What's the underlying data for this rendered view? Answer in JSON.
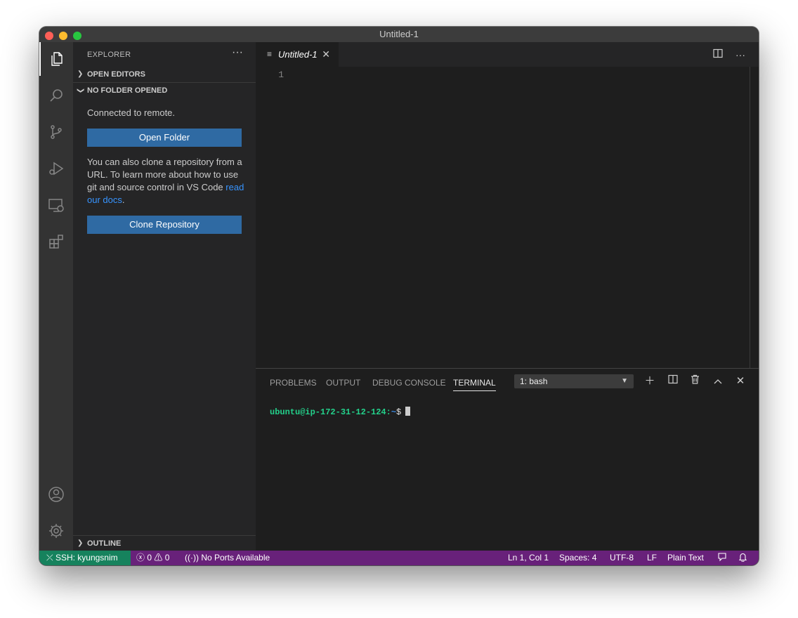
{
  "window": {
    "title": "Untitled-1"
  },
  "sidebar": {
    "title": "EXPLORER",
    "more": "···",
    "open_editors": "OPEN EDITORS",
    "no_folder": "NO FOLDER OPENED",
    "connected": "Connected to remote.",
    "open_folder_btn": "Open Folder",
    "clone_text_pre": "You can also clone a repository from a URL. To learn more about how to use git and source control in VS Code ",
    "clone_link": "read our docs",
    "clone_text_post": ".",
    "clone_btn": "Clone Repository",
    "outline": "OUTLINE"
  },
  "editor": {
    "tab_label": "Untitled-1",
    "line_number": "1",
    "split_icon": "split-editor-icon",
    "more": "···"
  },
  "panel": {
    "tabs": [
      "PROBLEMS",
      "OUTPUT",
      "DEBUG CONSOLE",
      "TERMINAL"
    ],
    "active_tab": "TERMINAL",
    "terminal_select": "1: bash",
    "prompt_user": "ubuntu@ip-172-31-12-124",
    "prompt_sep": ":",
    "prompt_path": "~",
    "prompt_dollar": "$"
  },
  "statusbar": {
    "remote": "SSH: kyungsnim",
    "errors": "0",
    "warnings": "0",
    "ports": "No Ports Available",
    "position": "Ln 1, Col 1",
    "spaces": "Spaces: 4",
    "encoding": "UTF-8",
    "eol": "LF",
    "language": "Plain Text"
  },
  "colors": {
    "status_bg": "#68217a",
    "remote_bg": "#16825d",
    "button_bg": "#2f6aa3",
    "prompt_green": "#23d18b"
  }
}
